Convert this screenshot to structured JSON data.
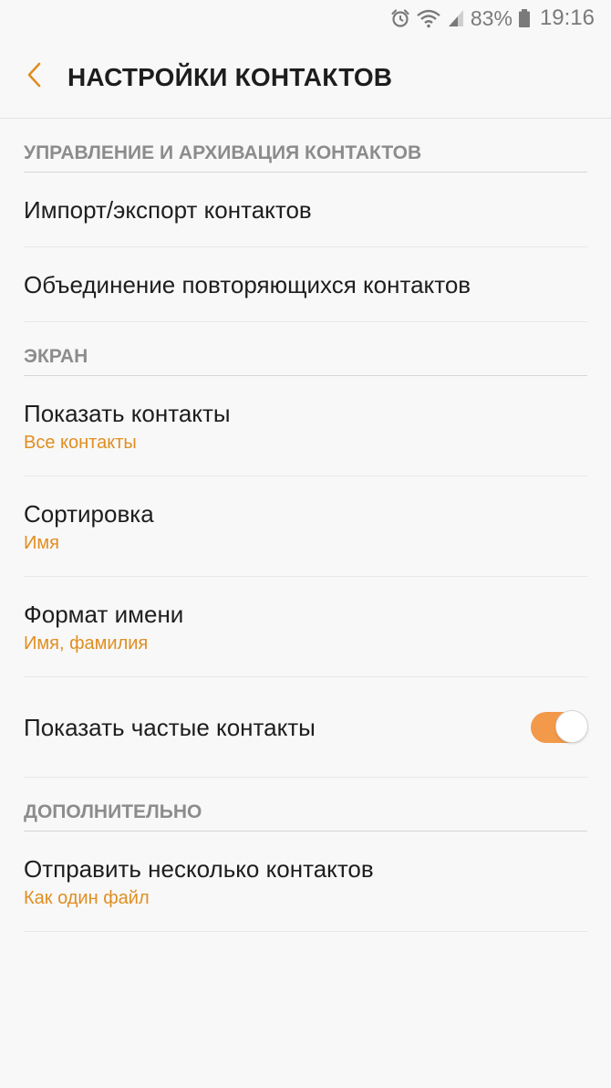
{
  "status_bar": {
    "battery_percent": "83%",
    "time": "19:16",
    "icons": [
      "alarm-icon",
      "wifi-icon",
      "signal-icon",
      "battery-icon"
    ]
  },
  "header": {
    "title": "НАСТРОЙКИ КОНТАКТОВ",
    "back_icon": "chevron-left-icon"
  },
  "colors": {
    "accent": "#e08e22",
    "toggle_on": "#f2994a",
    "section_header": "#8c8c8c",
    "background": "#f8f8f8"
  },
  "sections": [
    {
      "header": "УПРАВЛЕНИЕ И АРХИВАЦИЯ КОНТАКТОВ",
      "items": [
        {
          "title": "Импорт/экспорт контактов"
        },
        {
          "title": "Объединение повторяющихся контактов"
        }
      ]
    },
    {
      "header": "ЭКРАН",
      "items": [
        {
          "title": "Показать контакты",
          "subtitle": "Все контакты"
        },
        {
          "title": "Сортировка",
          "subtitle": "Имя"
        },
        {
          "title": "Формат имени",
          "subtitle": "Имя, фамилия"
        },
        {
          "title": "Показать частые контакты",
          "toggle": "on"
        }
      ]
    },
    {
      "header": "ДОПОЛНИТЕЛЬНО",
      "items": [
        {
          "title": "Отправить несколько контактов",
          "subtitle": "Как один файл"
        }
      ]
    }
  ]
}
